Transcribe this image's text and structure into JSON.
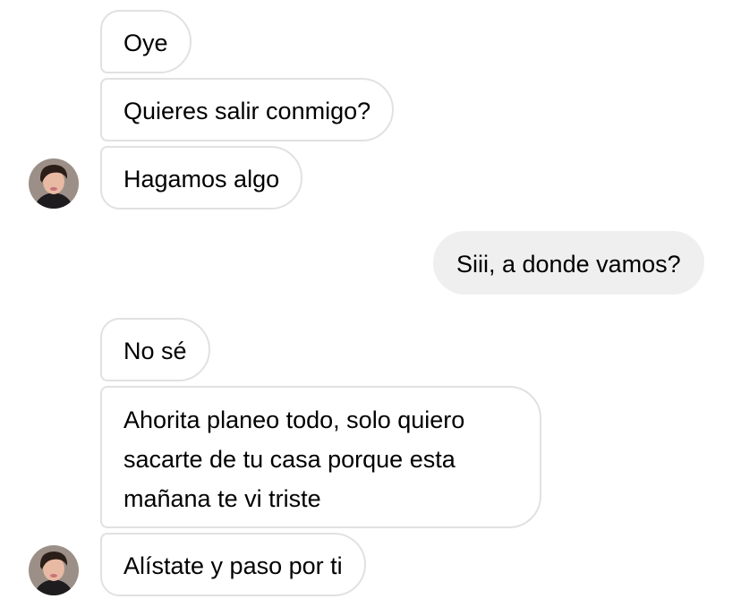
{
  "conversation": {
    "received_group_1": [
      "Oye",
      "Quieres salir conmigo?",
      "Hagamos algo"
    ],
    "sent_1": "Siii, a donde vamos?",
    "received_group_2": [
      "No sé",
      "Ahorita planeo todo, solo quiero\nsacarte de tu casa porque esta\nmañana te vi triste",
      "Alístate y paso por ti"
    ]
  },
  "avatar": {
    "icon": "contact-avatar-photo",
    "colors": {
      "hair": "#2b1d17",
      "skin": "#e8b9a3",
      "shirt": "#1e1c1e",
      "background": "#9c8f87"
    }
  },
  "colors": {
    "received_border": "#e1e1e1",
    "sent_background": "#efefef",
    "text": "#000000"
  }
}
